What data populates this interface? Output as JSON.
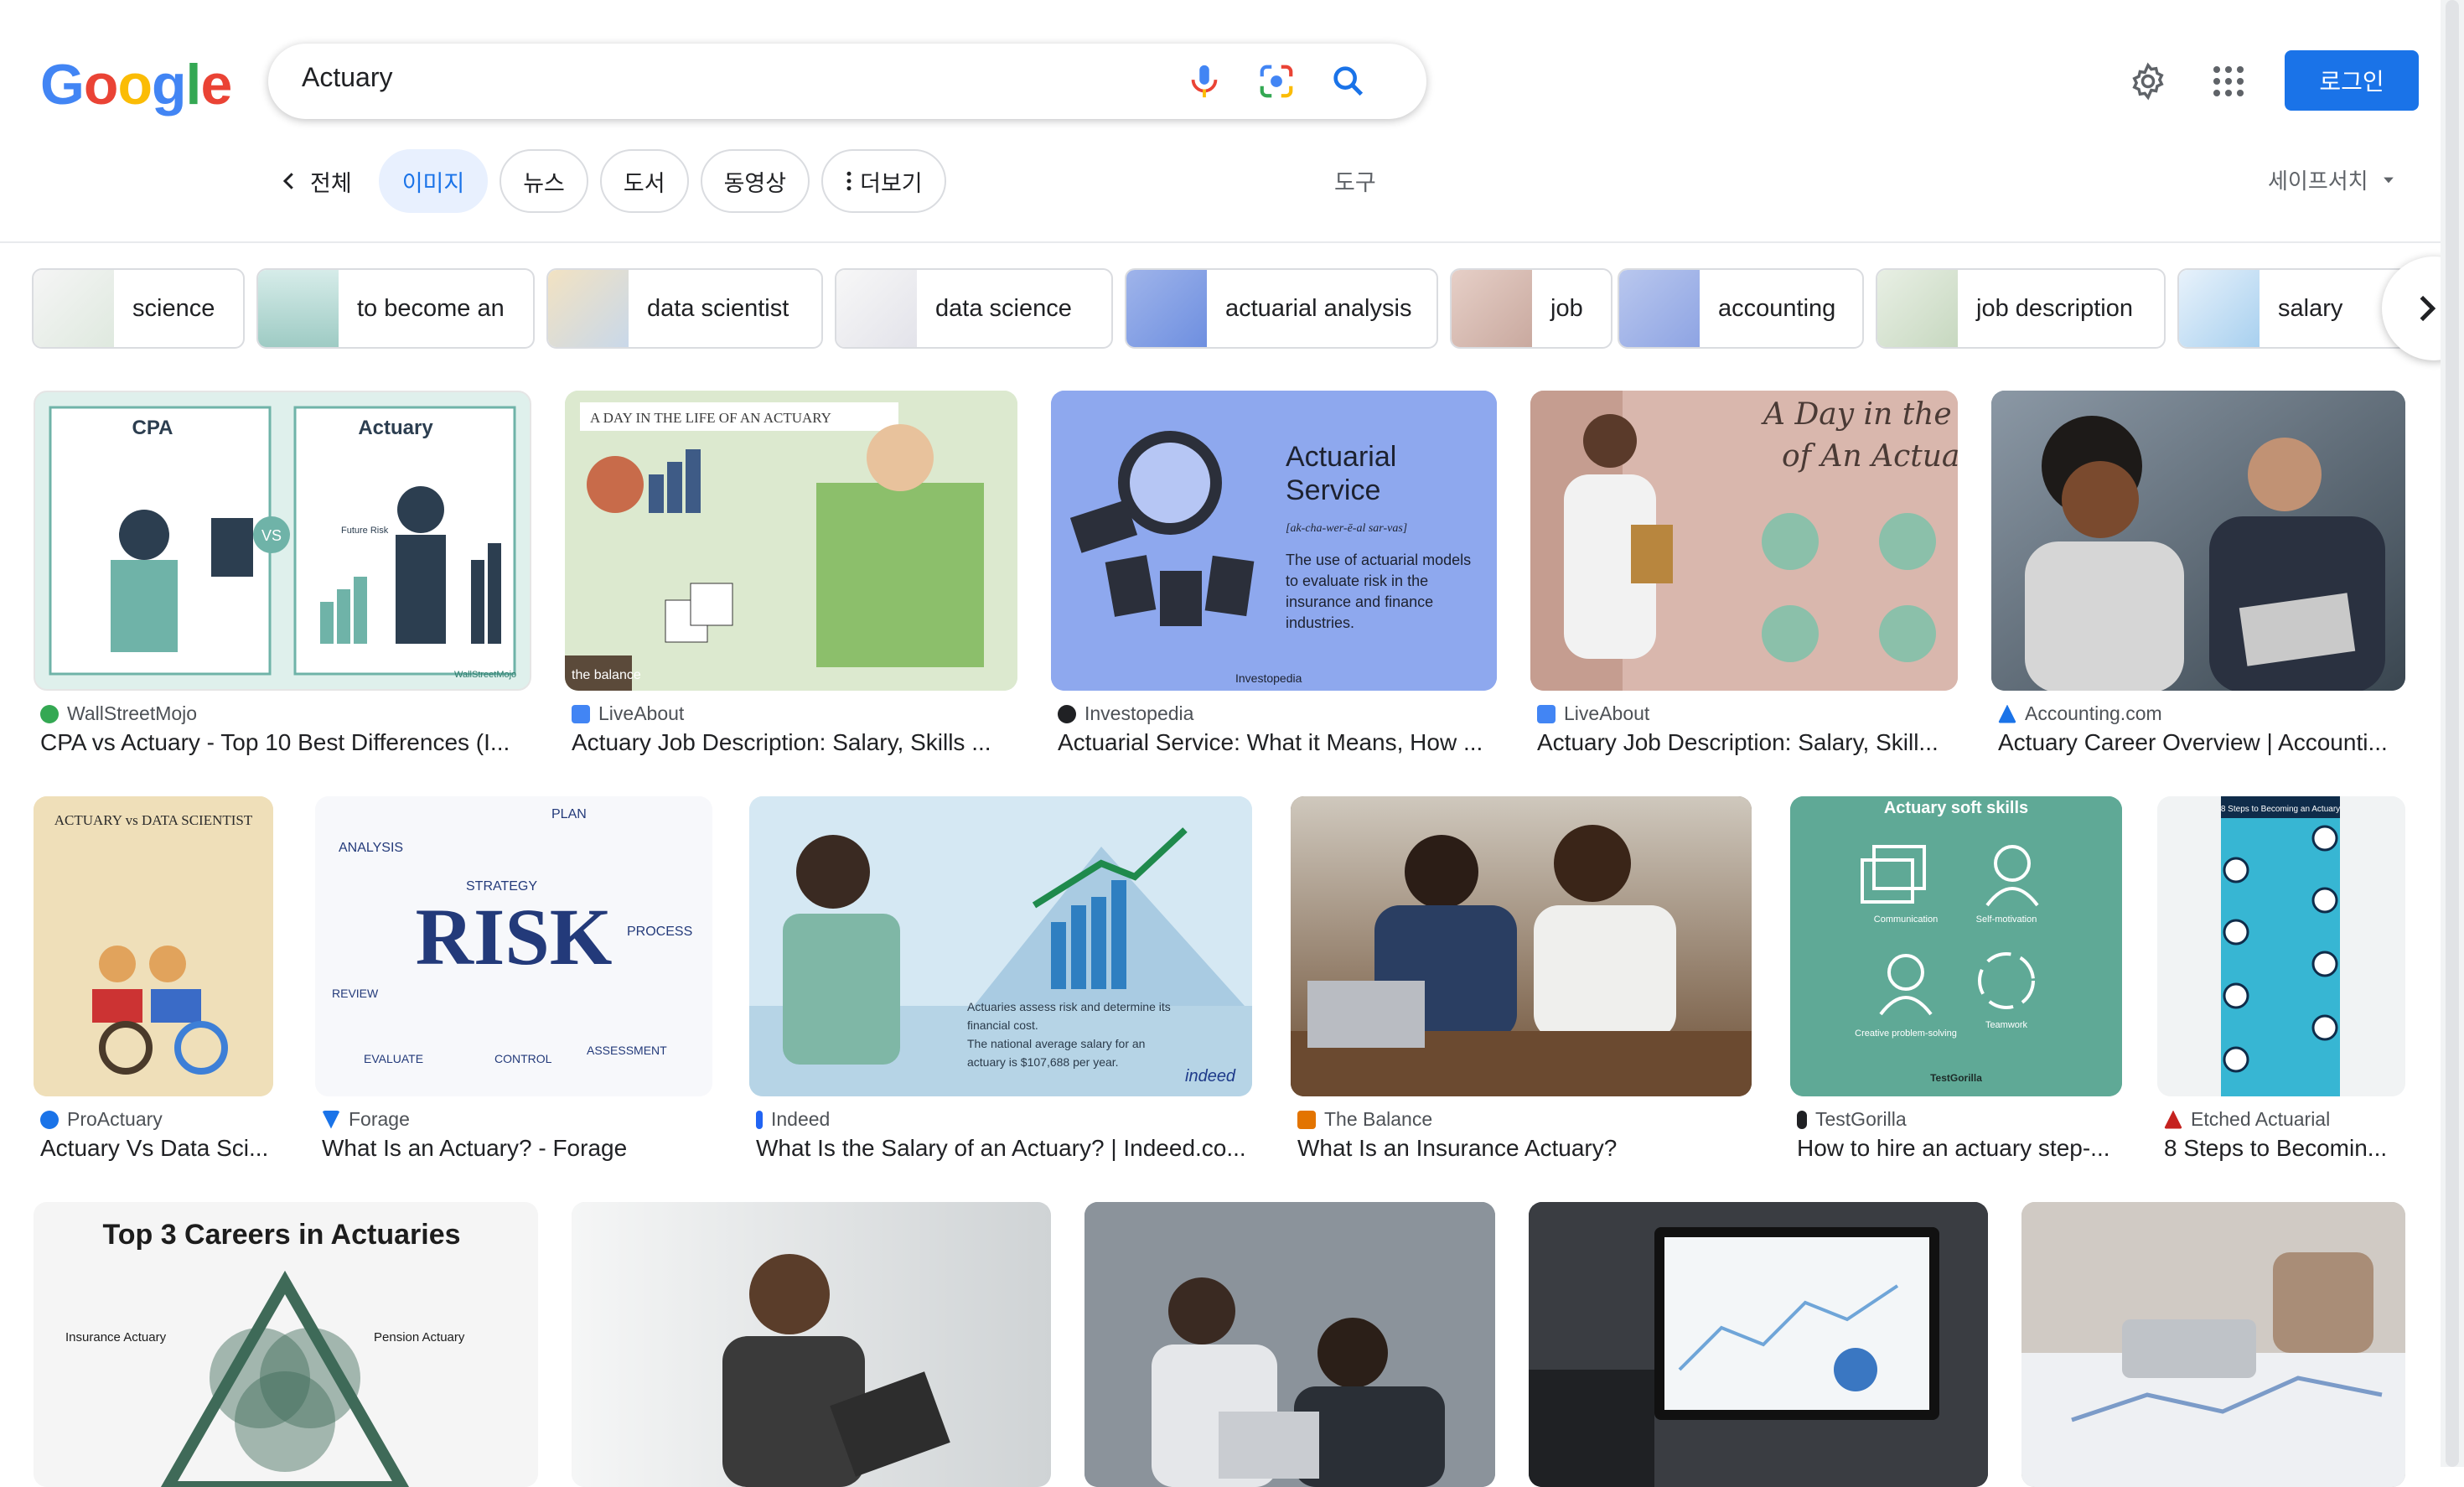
{
  "logo": {
    "text": "Google",
    "letters": [
      "G",
      "o",
      "o",
      "g",
      "l",
      "e"
    ],
    "colors": [
      "#4285F4",
      "#EA4335",
      "#FBBC05",
      "#4285F4",
      "#34A853",
      "#EA4335"
    ]
  },
  "search": {
    "query": "Actuary"
  },
  "header_right": {
    "login_label": "로그인"
  },
  "tabs": {
    "back_label": "전체",
    "items": [
      "이미지",
      "뉴스",
      "도서",
      "동영상"
    ],
    "more_label": "더보기",
    "active_index": 0
  },
  "tools_label": "도구",
  "safesearch_label": "세이프서치",
  "chips": [
    "science",
    "to become an",
    "data scientist",
    "data science",
    "actuarial analysis",
    "job",
    "accounting",
    "job description",
    "salary"
  ],
  "results": [
    {
      "source": "WallStreetMojo",
      "title": "CPA vs Actuary - Top 10 Best Differences (I...",
      "img_text": [
        "CPA",
        "Actuary",
        "VS",
        "Future Risk",
        "WallStreetMojo"
      ],
      "fav_color": "#34A853"
    },
    {
      "source": "LiveAbout",
      "title": "Actuary Job Description: Salary, Skills ...",
      "img_text": [
        "A DAY IN THE LIFE OF AN ACTUARY",
        "the balance"
      ],
      "fav_color": "#4285F4"
    },
    {
      "source": "Investopedia",
      "title": "Actuarial Service: What it Means, How ...",
      "img_text": [
        "Actuarial",
        "Service",
        "[ak-cha-wer-ē-al sar-vas]",
        "The use of actuarial models to evaluate risk in the insurance and finance industries.",
        "Investopedia"
      ],
      "fav_color": "#202124"
    },
    {
      "source": "LiveAbout",
      "title": "Actuary Job Description: Salary, Skill...",
      "img_text": [
        "A Day in the Life",
        "of An Actuary"
      ],
      "fav_color": "#4285F4"
    },
    {
      "source": "Accounting.com",
      "title": "Actuary Career Overview | Accounti...",
      "img_text": [],
      "fav_color": "#1a73e8"
    },
    {
      "source": "ProActuary",
      "title": "Actuary Vs Data Sci...",
      "img_text": [
        "ACTUARY vs DATA SCIENTIST"
      ],
      "fav_color": "#1a73e8"
    },
    {
      "source": "Forage",
      "title": "What Is an Actuary? - Forage",
      "img_text": [
        "RISK",
        "ANALYSIS",
        "STRATEGY",
        "PLAN",
        "PROCESS",
        "REVIEW",
        "EVALUATE",
        "CONTROL",
        "ASSESSMENT"
      ],
      "fav_color": "#1a73e8"
    },
    {
      "source": "Indeed",
      "title": "What Is the Salary of an Actuary? | Indeed.co...",
      "img_text": [
        "Actuaries assess risk and determine its financial cost.",
        "The national average salary for an actuary is $107,688 per year.",
        "indeed"
      ],
      "fav_color": "#2164f3"
    },
    {
      "source": "The Balance",
      "title": "What Is an Insurance Actuary?",
      "img_text": [],
      "fav_color": "#e37400"
    },
    {
      "source": "TestGorilla",
      "title": "How to hire an actuary step-...",
      "img_text": [
        "Actuary soft skills",
        "Communication",
        "Self-motivation",
        "Creative problem-solving",
        "Teamwork",
        "TestGorilla"
      ],
      "fav_color": "#202124"
    },
    {
      "source": "Etched Actuarial",
      "title": "8 Steps to Becomin...",
      "img_text": [
        "8 Steps to Becoming an Actuary"
      ],
      "fav_color": "#c5221f"
    },
    {
      "source": "",
      "title": "",
      "img_text": [
        "Top 3 Careers in Actuaries",
        "Insurance Actuary",
        "Pension Actuary"
      ],
      "fav_color": ""
    },
    {
      "source": "",
      "title": "",
      "img_text": [],
      "fav_color": ""
    },
    {
      "source": "",
      "title": "",
      "img_text": [],
      "fav_color": ""
    },
    {
      "source": "",
      "title": "",
      "img_text": [],
      "fav_color": ""
    },
    {
      "source": "",
      "title": "",
      "img_text": [],
      "fav_color": ""
    }
  ],
  "colors": {
    "accent": "#1a73e8",
    "active_tab_bg": "#e8f0fe"
  }
}
